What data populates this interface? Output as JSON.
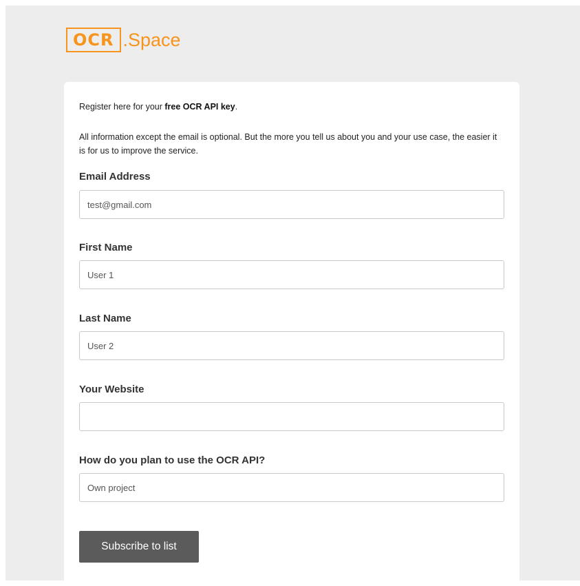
{
  "logo": {
    "box_text": "OCR",
    "rest_text": ".Space",
    "color": "#f7941d"
  },
  "intro": {
    "prefix": "Register here for your ",
    "bold": "free OCR API key",
    "suffix": "."
  },
  "info_text": "All information except the email is optional. But the more you tell us about you and your use case, the easier it is for us to improve the service.",
  "form": {
    "email": {
      "label": "Email Address",
      "value": "test@gmail.com"
    },
    "first_name": {
      "label": "First Name",
      "value": "User 1"
    },
    "last_name": {
      "label": "Last Name",
      "value": "User 2"
    },
    "website": {
      "label": "Your Website",
      "value": ""
    },
    "usage": {
      "label": "How do you plan to use the OCR API?",
      "value": "Own project"
    }
  },
  "submit_label": "Subscribe to list",
  "colors": {
    "background": "#ededed",
    "card": "#ffffff",
    "button": "#5b5b5b",
    "accent": "#f7941d"
  }
}
